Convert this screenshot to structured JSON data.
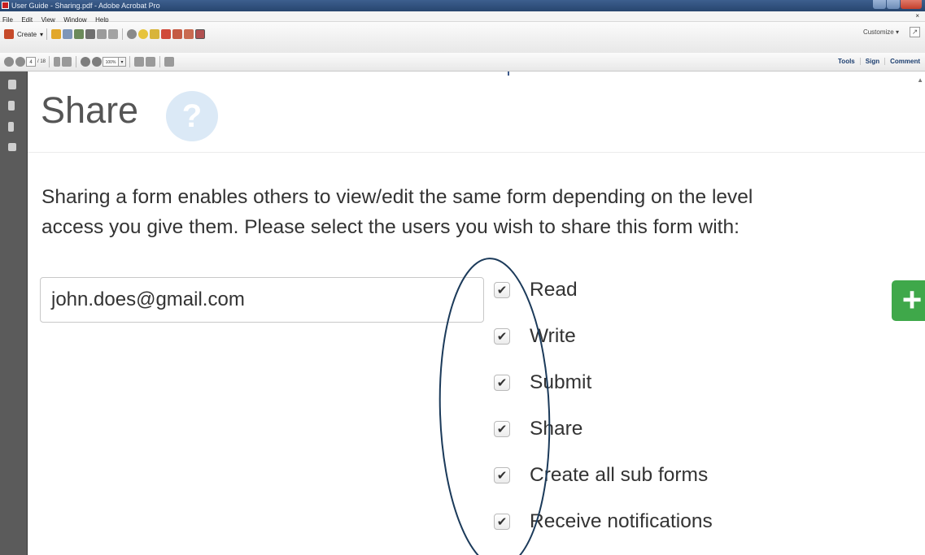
{
  "window": {
    "title": "User Guide - Sharing.pdf - Adobe Acrobat Pro",
    "colors": {
      "titlebar": "#2f5080",
      "nav_pane": "#5b5b5b"
    }
  },
  "menu": [
    "File",
    "Edit",
    "View",
    "Window",
    "Help"
  ],
  "toolbar": {
    "create_label": "Create",
    "customize_label": "Customize",
    "page_current": "4",
    "page_total": "/ 18",
    "zoom": "100%",
    "panels": [
      "Tools",
      "Sign",
      "Comment"
    ],
    "icons": [
      "open-icon",
      "save-icon",
      "upload-icon",
      "print-icon",
      "edit-icon",
      "email-icon",
      "settings-icon",
      "comment-icon",
      "stamp-icon",
      "pdf-icon",
      "pdf-export-icon",
      "pdf-export-icon",
      "redact-icon"
    ]
  },
  "document": {
    "title": "Share",
    "help_icon_glyph": "?",
    "intro_lines": [
      "Sharing a form enables others to view/edit the same form depending on the level",
      "access you give them. Please select the users you wish to share this form with:"
    ],
    "email_value": "john.does@gmail.com",
    "add_button_glyph": "+",
    "permissions": [
      {
        "label": "Read",
        "checked": true
      },
      {
        "label": "Write",
        "checked": true
      },
      {
        "label": "Submit",
        "checked": true
      },
      {
        "label": "Share",
        "checked": true
      },
      {
        "label": "Create all sub forms",
        "checked": true
      },
      {
        "label": "Receive notifications",
        "checked": true
      }
    ],
    "colors": {
      "add_button": "#3fa84a",
      "help_circle": "#dbe9f6",
      "annotation": "#1b3a5a"
    }
  }
}
